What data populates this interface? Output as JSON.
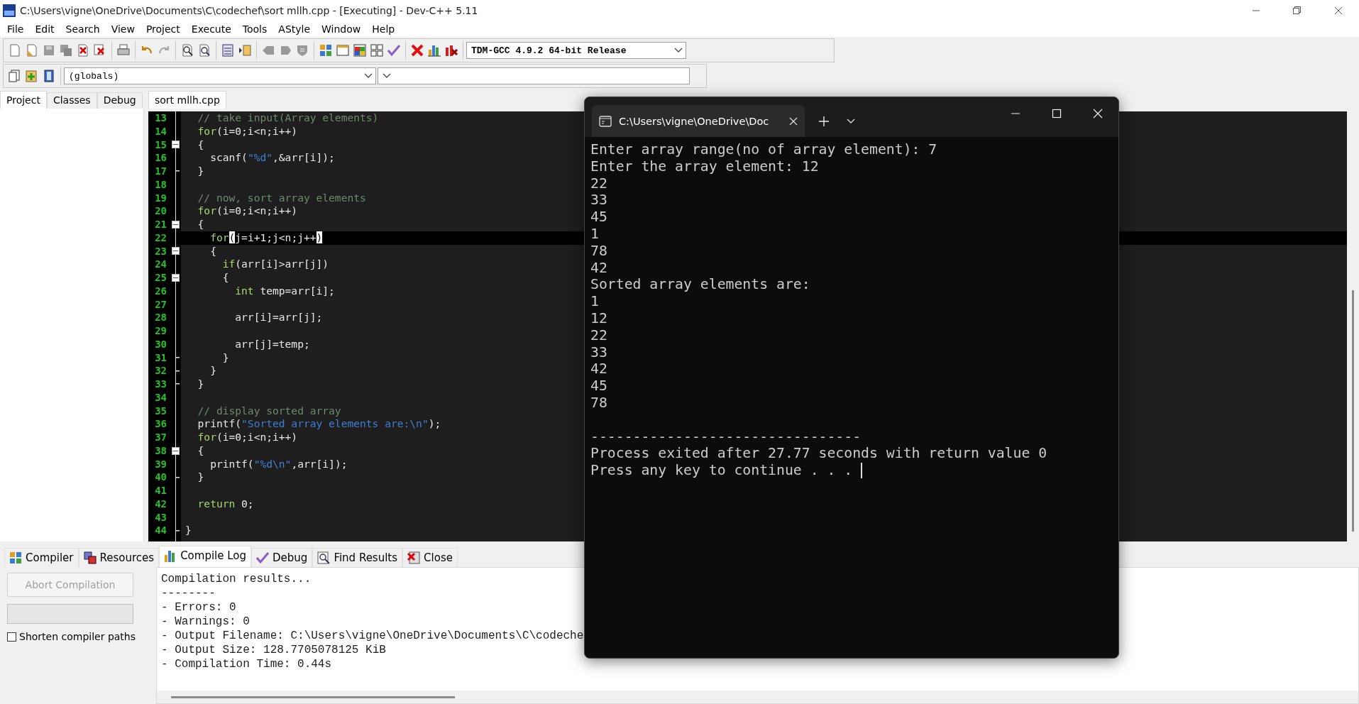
{
  "window": {
    "title": "C:\\Users\\vigne\\OneDrive\\Documents\\C\\codechef\\sort mllh.cpp - [Executing] - Dev-C++ 5.11"
  },
  "menu": [
    "File",
    "Edit",
    "Search",
    "View",
    "Project",
    "Execute",
    "Tools",
    "AStyle",
    "Window",
    "Help"
  ],
  "toolbar": {
    "compiler_select": "TDM-GCC 4.9.2 64-bit Release",
    "scope_select": "(globals)"
  },
  "left_panel": {
    "tabs": [
      {
        "label": "Project",
        "selected": true
      },
      {
        "label": "Classes",
        "selected": false
      },
      {
        "label": "Debug",
        "selected": false
      }
    ]
  },
  "editor": {
    "tabs": [
      {
        "label": "sort mllh.cpp",
        "selected": true
      }
    ],
    "lines": [
      {
        "number": "13",
        "collapsible": false,
        "block_end": false,
        "current": false,
        "tokens": [
          {
            "kind": "comment",
            "text": "  // take input(Array elements)"
          }
        ]
      },
      {
        "number": "14",
        "collapsible": false,
        "block_end": false,
        "current": false,
        "tokens": [
          {
            "kind": "keyword",
            "text": "  for"
          },
          {
            "kind": "plain",
            "text": "(i=0;i<n;i++)"
          }
        ]
      },
      {
        "number": "15",
        "collapsible": true,
        "block_end": false,
        "current": false,
        "tokens": [
          {
            "kind": "plain",
            "text": "  {"
          }
        ]
      },
      {
        "number": "16",
        "collapsible": false,
        "block_end": false,
        "current": false,
        "tokens": [
          {
            "kind": "plain",
            "text": "    scanf("
          },
          {
            "kind": "string",
            "text": "\"%d\""
          },
          {
            "kind": "plain",
            "text": ",&arr[i]);"
          }
        ]
      },
      {
        "number": "17",
        "collapsible": false,
        "block_end": true,
        "current": false,
        "tokens": [
          {
            "kind": "plain",
            "text": "  }"
          }
        ]
      },
      {
        "number": "18",
        "collapsible": false,
        "block_end": false,
        "current": false
      },
      {
        "number": "19",
        "collapsible": false,
        "block_end": false,
        "current": false,
        "tokens": [
          {
            "kind": "comment",
            "text": "  // now, sort array elements"
          }
        ]
      },
      {
        "number": "20",
        "collapsible": false,
        "block_end": false,
        "current": false,
        "tokens": [
          {
            "kind": "keyword",
            "text": "  for"
          },
          {
            "kind": "plain",
            "text": "(i=0;i<n;i++)"
          }
        ]
      },
      {
        "number": "21",
        "collapsible": true,
        "block_end": false,
        "current": false,
        "tokens": [
          {
            "kind": "plain",
            "text": "  {"
          }
        ]
      },
      {
        "number": "22",
        "collapsible": false,
        "block_end": false,
        "current": true,
        "tokens": [
          {
            "kind": "keyword",
            "text": "    for"
          },
          {
            "kind": "match",
            "text": "("
          },
          {
            "kind": "plain",
            "text": "j=i+1;j<n;j++"
          },
          {
            "kind": "match",
            "text": ")"
          }
        ]
      },
      {
        "number": "23",
        "collapsible": true,
        "block_end": false,
        "current": false,
        "tokens": [
          {
            "kind": "plain",
            "text": "    {"
          }
        ]
      },
      {
        "number": "24",
        "collapsible": false,
        "block_end": false,
        "current": false,
        "tokens": [
          {
            "kind": "keyword",
            "text": "      if"
          },
          {
            "kind": "plain",
            "text": "(arr[i]>arr[j])"
          }
        ]
      },
      {
        "number": "25",
        "collapsible": true,
        "block_end": false,
        "current": false,
        "tokens": [
          {
            "kind": "plain",
            "text": "      {"
          }
        ]
      },
      {
        "number": "26",
        "collapsible": false,
        "block_end": false,
        "current": false,
        "tokens": [
          {
            "kind": "keyword",
            "text": "        int"
          },
          {
            "kind": "plain",
            "text": " temp=arr[i];"
          }
        ]
      },
      {
        "number": "27",
        "collapsible": false,
        "block_end": false,
        "current": false
      },
      {
        "number": "28",
        "collapsible": false,
        "block_end": false,
        "current": false,
        "tokens": [
          {
            "kind": "plain",
            "text": "        arr[i]=arr[j];"
          }
        ]
      },
      {
        "number": "29",
        "collapsible": false,
        "block_end": false,
        "current": false
      },
      {
        "number": "30",
        "collapsible": false,
        "block_end": false,
        "current": false,
        "tokens": [
          {
            "kind": "plain",
            "text": "        arr[j]=temp;"
          }
        ]
      },
      {
        "number": "31",
        "collapsible": false,
        "block_end": true,
        "current": false,
        "tokens": [
          {
            "kind": "plain",
            "text": "      }"
          }
        ]
      },
      {
        "number": "32",
        "collapsible": false,
        "block_end": true,
        "current": false,
        "tokens": [
          {
            "kind": "plain",
            "text": "    }"
          }
        ]
      },
      {
        "number": "33",
        "collapsible": false,
        "block_end": true,
        "current": false,
        "tokens": [
          {
            "kind": "plain",
            "text": "  }"
          }
        ]
      },
      {
        "number": "34",
        "collapsible": false,
        "block_end": false,
        "current": false
      },
      {
        "number": "35",
        "collapsible": false,
        "block_end": false,
        "current": false,
        "tokens": [
          {
            "kind": "comment",
            "text": "  // display sorted array"
          }
        ]
      },
      {
        "number": "36",
        "collapsible": false,
        "block_end": false,
        "current": false,
        "tokens": [
          {
            "kind": "plain",
            "text": "  printf("
          },
          {
            "kind": "string",
            "text": "\"Sorted array elements are:\\n\""
          },
          {
            "kind": "plain",
            "text": ");"
          }
        ]
      },
      {
        "number": "37",
        "collapsible": false,
        "block_end": false,
        "current": false,
        "tokens": [
          {
            "kind": "keyword",
            "text": "  for"
          },
          {
            "kind": "plain",
            "text": "(i=0;i<n;i++)"
          }
        ]
      },
      {
        "number": "38",
        "collapsible": true,
        "block_end": false,
        "current": false,
        "tokens": [
          {
            "kind": "plain",
            "text": "  {"
          }
        ]
      },
      {
        "number": "39",
        "collapsible": false,
        "block_end": false,
        "current": false,
        "tokens": [
          {
            "kind": "plain",
            "text": "    printf("
          },
          {
            "kind": "string",
            "text": "\"%d\\n\""
          },
          {
            "kind": "plain",
            "text": ",arr[i]);"
          }
        ]
      },
      {
        "number": "40",
        "collapsible": false,
        "block_end": true,
        "current": false,
        "tokens": [
          {
            "kind": "plain",
            "text": "  }"
          }
        ]
      },
      {
        "number": "41",
        "collapsible": false,
        "block_end": false,
        "current": false
      },
      {
        "number": "42",
        "collapsible": false,
        "block_end": false,
        "current": false,
        "tokens": [
          {
            "kind": "keyword",
            "text": "  return"
          },
          {
            "kind": "plain",
            "text": " 0;"
          }
        ]
      },
      {
        "number": "43",
        "collapsible": false,
        "block_end": false,
        "current": false
      },
      {
        "number": "44",
        "collapsible": false,
        "block_end": true,
        "current": false,
        "tokens": [
          {
            "kind": "plain",
            "text": "}"
          }
        ]
      }
    ]
  },
  "bottom_panel": {
    "tabs": [
      {
        "label": "Compiler",
        "selected": false
      },
      {
        "label": "Resources",
        "selected": false
      },
      {
        "label": "Compile Log",
        "selected": true
      },
      {
        "label": "Debug",
        "selected": false
      },
      {
        "label": "Find Results",
        "selected": false
      },
      {
        "label": "Close",
        "selected": false
      }
    ],
    "abort_button": {
      "label": "Abort Compilation",
      "disabled": true
    },
    "progress": {
      "level": 0
    },
    "shorten_paths": {
      "label": "Shorten compiler paths",
      "checked": false
    },
    "log": [
      "Compilation results...",
      "--------",
      "- Errors: 0",
      "- Warnings: 0",
      "- Output Filename: C:\\Users\\vigne\\OneDrive\\Documents\\C\\codeche",
      "- Output Size: 128.7705078125 KiB",
      "- Compilation Time: 0.44s"
    ]
  },
  "console": {
    "tab_title": "C:\\Users\\vigne\\OneDrive\\Doc",
    "lines": [
      "Enter array range(no of array element): 7",
      "Enter the array element: 12",
      "22",
      "33",
      "45",
      "1",
      "78",
      "42",
      "Sorted array elements are:",
      "1",
      "12",
      "22",
      "33",
      "42",
      "45",
      "78"
    ],
    "summary": [
      "--------------------------------",
      "Process exited after 27.77 seconds with return value 0",
      "Press any key to continue . . . "
    ]
  }
}
